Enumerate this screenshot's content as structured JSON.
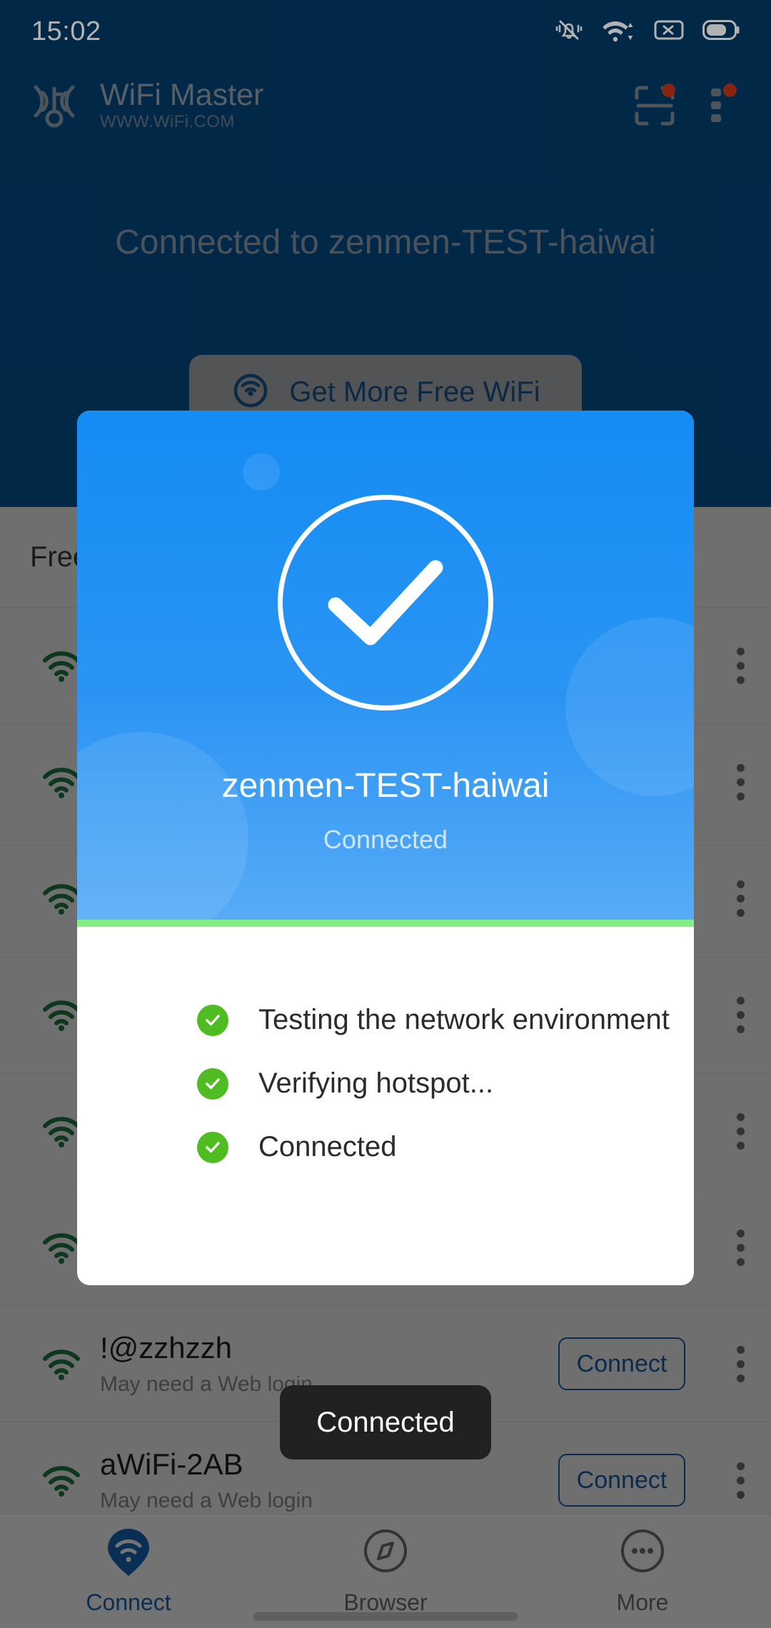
{
  "status_bar": {
    "time": "15:02",
    "icons": [
      "silent-bell-icon",
      "wifi-icon",
      "sim-card-disabled-icon",
      "battery-icon"
    ]
  },
  "app_bar": {
    "brand_title": "WiFi Master",
    "brand_subtitle": "WWW.WiFi.COM",
    "logo_icon": "wifi-key-icon",
    "scan_icon": "scan-qr-icon",
    "overflow_icon": "overflow-menu-icon",
    "scan_badge": true,
    "overflow_badge": true
  },
  "hero": {
    "headline": "Connected to zenmen-TEST-haiwai",
    "get_more_button": "Get More Free WiFi",
    "get_more_icon": "wifi-radar-icon"
  },
  "list": {
    "header": "Free WiFi",
    "connect_label": "Connect",
    "note": "May need a Web login",
    "rows": [
      {
        "ssid": "",
        "note": ""
      },
      {
        "ssid": "",
        "note": ""
      },
      {
        "ssid": "",
        "note": ""
      },
      {
        "ssid": "",
        "note": ""
      },
      {
        "ssid": "",
        "note": ""
      },
      {
        "ssid": "",
        "note": ""
      },
      {
        "ssid": "!@zzhzzh",
        "note": "May need a Web login"
      },
      {
        "ssid": "aWiFi-2AB",
        "note": "May need a Web login"
      }
    ]
  },
  "modal": {
    "ssid": "zenmen-TEST-haiwai",
    "state": "Connected",
    "check_icon": "check-circle-icon",
    "divider_color": "#84ee83",
    "steps": [
      {
        "label": "Testing the network environment",
        "icon": "green-check-icon",
        "done": true
      },
      {
        "label": "Verifying hotspot...",
        "icon": "green-check-icon",
        "done": true
      },
      {
        "label": "Connected",
        "icon": "green-check-icon",
        "done": true
      }
    ]
  },
  "toast": {
    "text": "Connected"
  },
  "bottom_nav": {
    "items": [
      {
        "label": "Connect",
        "icon": "wifi-pin-icon",
        "active": true
      },
      {
        "label": "Browser",
        "icon": "compass-icon",
        "active": false
      },
      {
        "label": "More",
        "icon": "more-circle-icon",
        "active": false
      }
    ]
  },
  "colors": {
    "app_bg": "#043a68",
    "accent_blue": "#148cf5",
    "brand_blue": "#1668b8",
    "green": "#4fbd22",
    "divider_green": "#84ee83",
    "toast_bg": "#212121"
  }
}
